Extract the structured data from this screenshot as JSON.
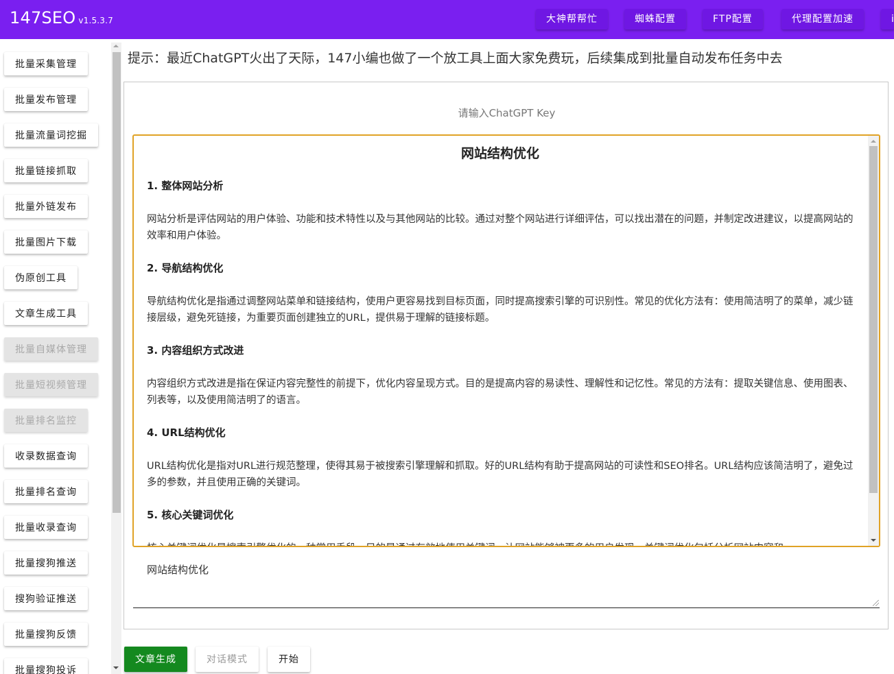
{
  "header": {
    "app_name": "147SEO",
    "version": "v1.5.3.7",
    "buttons": [
      "大神帮帮忙",
      "蜘蛛配置",
      "FTP配置",
      "代理配置加速",
      "i"
    ]
  },
  "sidebar": {
    "items": [
      {
        "label": "批量采集管理",
        "disabled": false
      },
      {
        "label": "批量发布管理",
        "disabled": false
      },
      {
        "label": "批量流量词挖掘",
        "disabled": false
      },
      {
        "label": "批量链接抓取",
        "disabled": false
      },
      {
        "label": "批量外链发布",
        "disabled": false
      },
      {
        "label": "批量图片下载",
        "disabled": false
      },
      {
        "label": "伪原创工具",
        "disabled": false
      },
      {
        "label": "文章生成工具",
        "disabled": false
      },
      {
        "label": "批量自媒体管理",
        "disabled": true
      },
      {
        "label": "批量短视频管理",
        "disabled": true
      },
      {
        "label": "批量排名监控",
        "disabled": true
      },
      {
        "label": "收录数据查询",
        "disabled": false
      },
      {
        "label": "批量排名查询",
        "disabled": false
      },
      {
        "label": "批量收录查询",
        "disabled": false
      },
      {
        "label": "批量搜狗推送",
        "disabled": false
      },
      {
        "label": "搜狗验证推送",
        "disabled": false
      },
      {
        "label": "批量搜狗反馈",
        "disabled": false
      },
      {
        "label": "批量搜狗投诉",
        "disabled": false
      }
    ]
  },
  "main": {
    "tip": "提示：最近ChatGPT火出了天际，147小编也做了一个放工具上面大家免费玩，后续集成到批量自动发布任务中去",
    "key_placeholder": "请输入ChatGPT Key",
    "output": {
      "title": "网站结构优化",
      "sections": [
        {
          "heading": "1. 整体网站分析",
          "body": "网站分析是评估网站的用户体验、功能和技术特性以及与其他网站的比较。通过对整个网站进行详细评估，可以找出潜在的问题，并制定改进建议，以提高网站的效率和用户体验。"
        },
        {
          "heading": "2. 导航结构优化",
          "body": "导航结构优化是指通过调整网站菜单和链接结构，使用户更容易找到目标页面，同时提高搜索引擎的可识别性。常见的优化方法有：使用简洁明了的菜单，减少链接层级，避免死链接，为重要页面创建独立的URL，提供易于理解的链接标题。"
        },
        {
          "heading": "3. 内容组织方式改进",
          "body": "内容组织方式改进是指在保证内容完整性的前提下，优化内容呈现方式。目的是提高内容的易读性、理解性和记忆性。常见的方法有：提取关键信息、使用图表、列表等，以及使用简洁明了的语言。"
        },
        {
          "heading": "4. URL结构优化",
          "body": "URL结构优化是指对URL进行规范整理，使得其易于被搜索引擎理解和抓取。好的URL结构有助于提高网站的可读性和SEO排名。URL结构应该简洁明了，避免过多的参数，并且使用正确的关键词。"
        },
        {
          "heading": "5. 核心关键词优化",
          "body": "核心关键词优化是搜索引擎优化的一种常用手段，目的是通过有效地使用关键词，让网站能够被更多的用户发现。关键词优化包括分析网站内容和"
        }
      ]
    },
    "prompt_value": "网站结构优化",
    "actions": {
      "generate": "文章生成",
      "chat_mode": "对话模式",
      "start": "开始"
    }
  },
  "colors": {
    "header_bg": "#7a1ff0",
    "output_border": "#e0a225",
    "generate_bg": "#14891f"
  }
}
